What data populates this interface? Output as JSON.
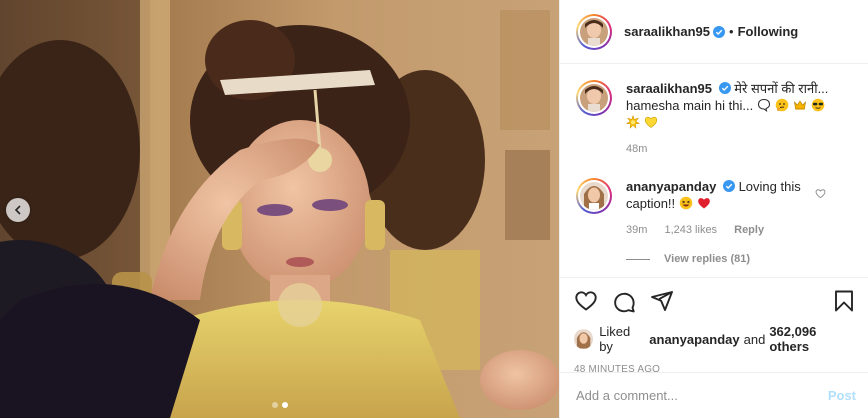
{
  "header": {
    "username": "saraalikhan95",
    "separator": "•",
    "follow_state": "Following"
  },
  "caption": {
    "username": "saraalikhan95",
    "text_line1": "मेरे सपनों की रानी...",
    "text_line2": "hamesha main hi thi...",
    "emojis": [
      "speech-bubble",
      "thinking-face",
      "crown",
      "sunglasses-face",
      "sparkle-burst",
      "yellow-heart"
    ],
    "time": "48m"
  },
  "comment": {
    "username": "ananyapanday",
    "text": "Loving this caption!!",
    "emojis": [
      "grinning-squint-face",
      "red-heart"
    ],
    "time": "39m",
    "likes": "1,243 likes",
    "reply_label": "Reply",
    "view_replies": "View replies (81)"
  },
  "likes": {
    "prefix": "Liked by",
    "user": "ananyapanday",
    "and": "and",
    "others": "362,096 others"
  },
  "timestamp": "48 MINUTES AGO",
  "add_comment": {
    "placeholder": "Add a comment...",
    "post_label": "Post"
  },
  "carousel": {
    "total": 2,
    "current": 2
  },
  "colors": {
    "accent_blue": "#0095f6",
    "verified_blue": "#3897f0",
    "post_disabled": "#b2dffc",
    "muted": "#8e8e8e",
    "text": "#262626"
  }
}
